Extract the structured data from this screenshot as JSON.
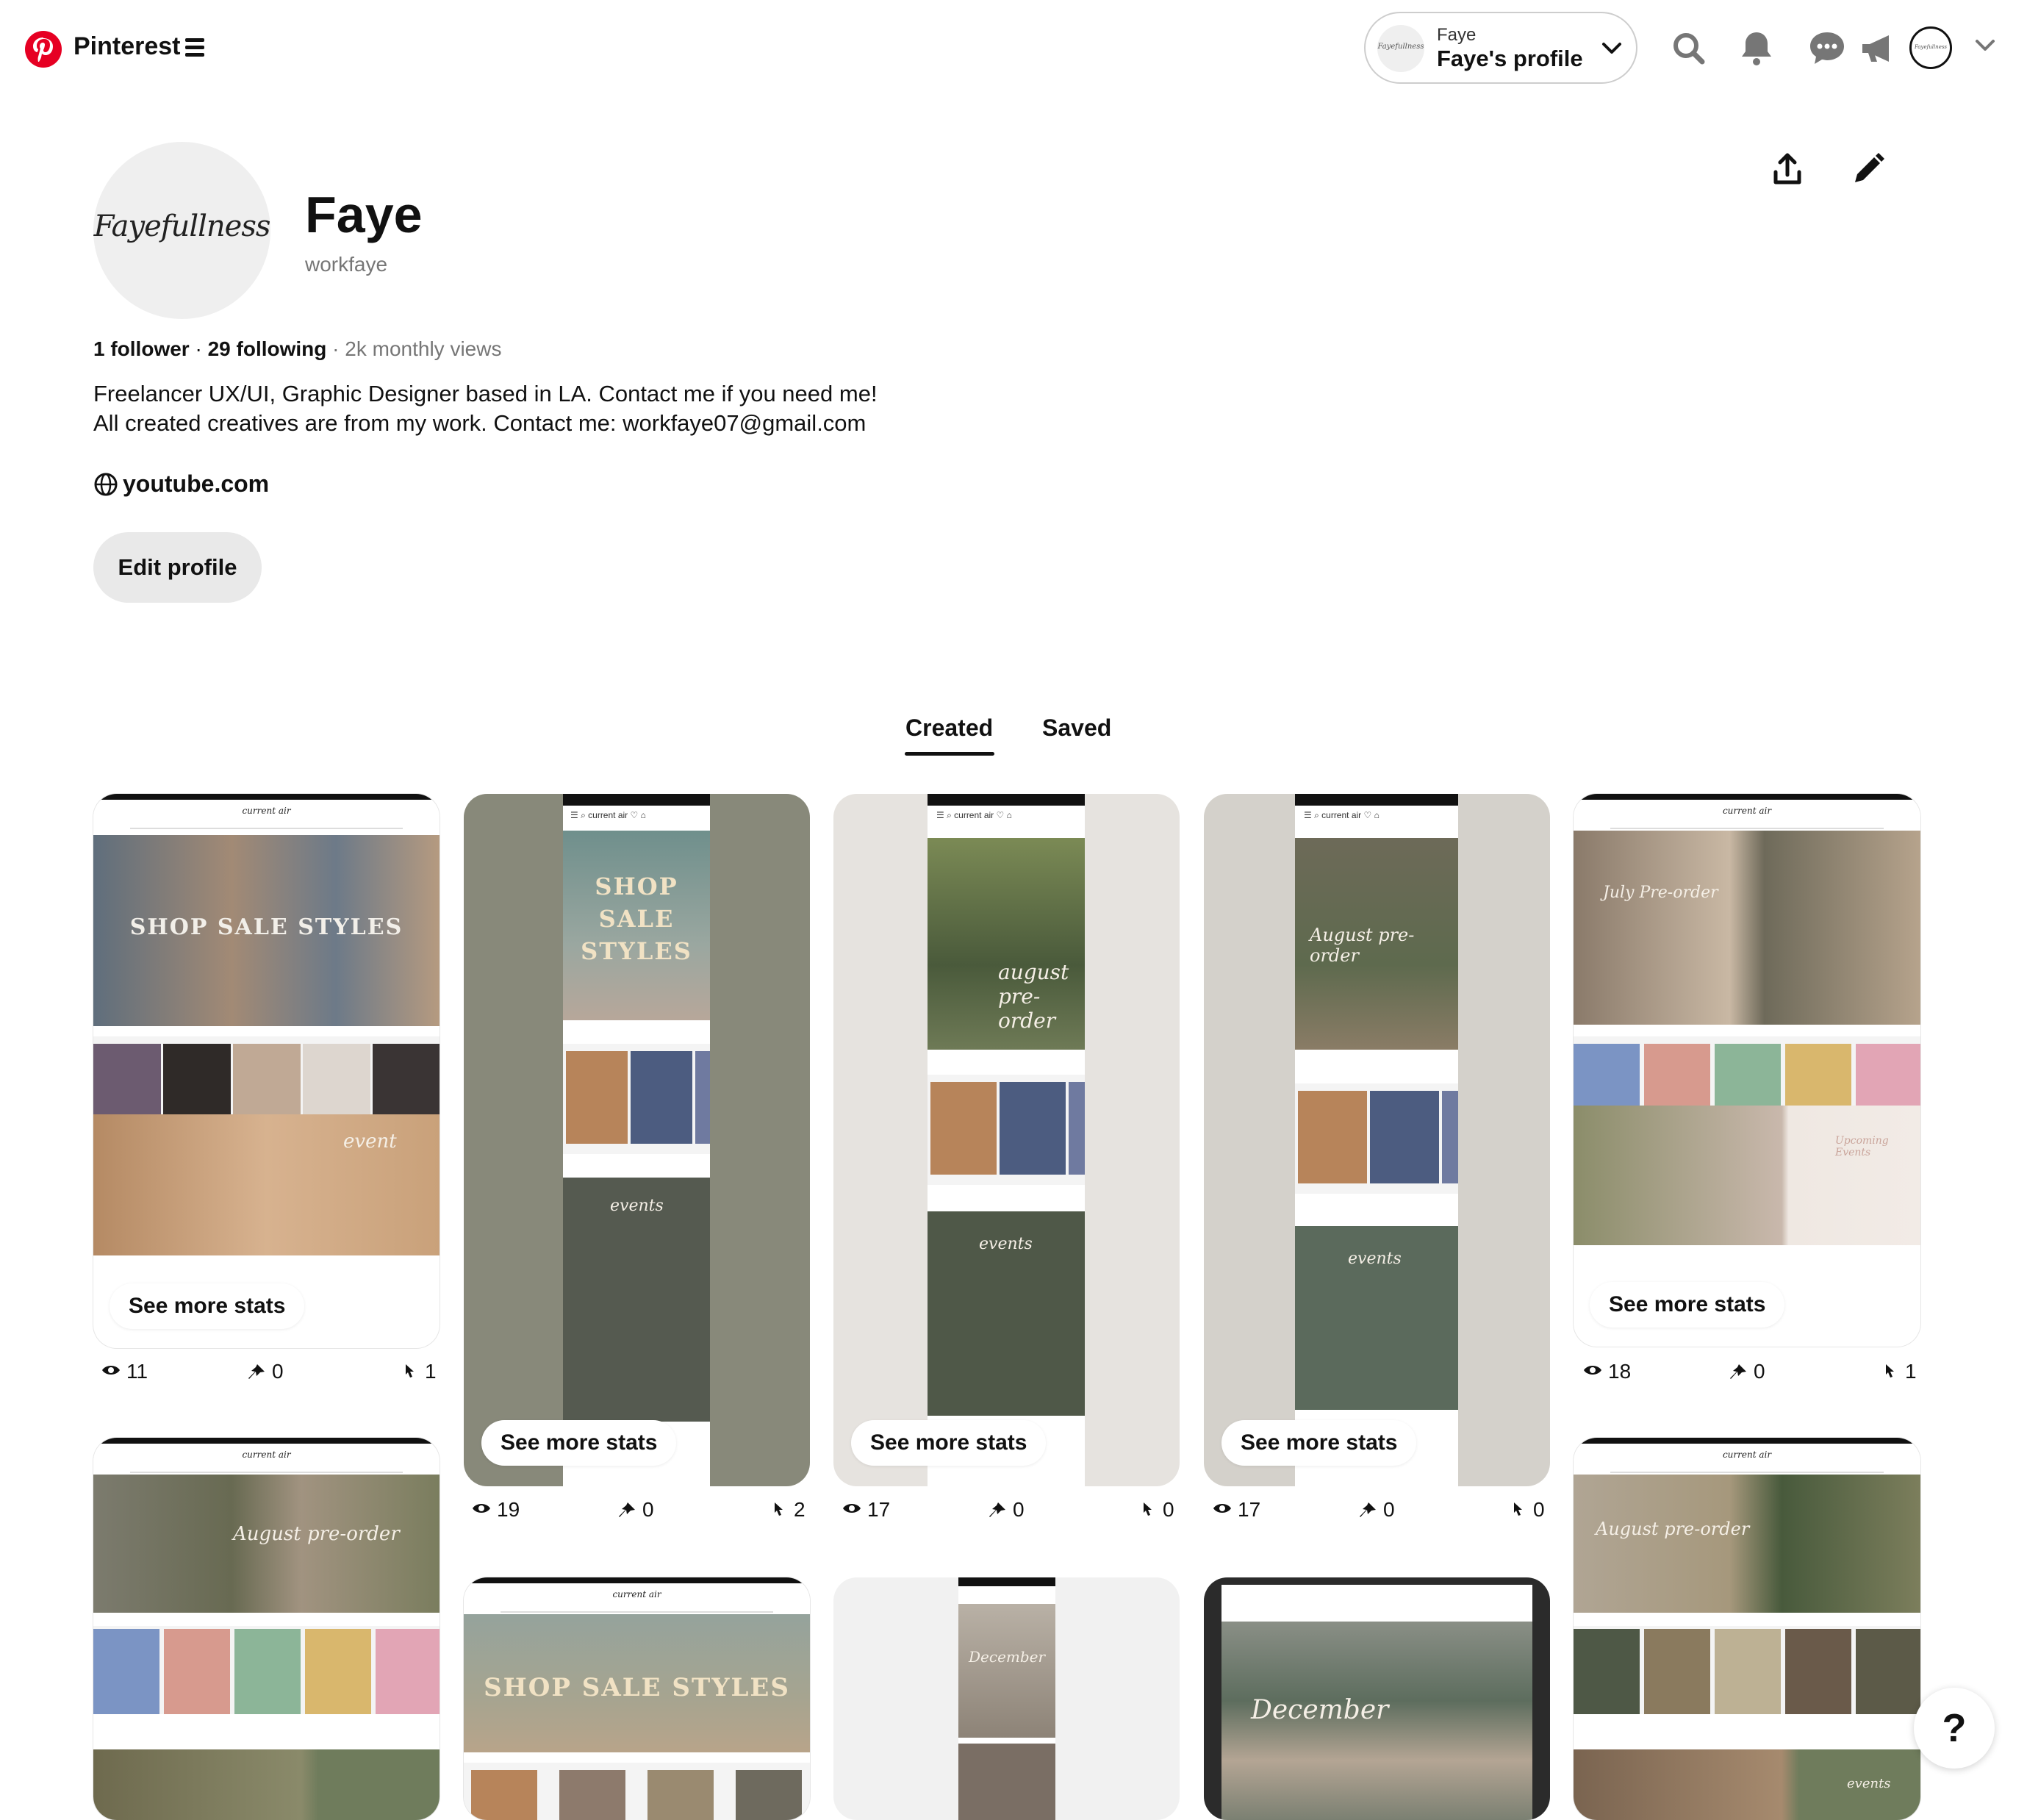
{
  "header": {
    "brand": "Pinterest",
    "account_switcher": {
      "name": "Faye",
      "profile_label": "Faye's profile",
      "avatar_text": "Fayefullness"
    },
    "icons": [
      "search-icon",
      "bell-icon",
      "messages-icon",
      "megaphone-icon"
    ],
    "avatar_text": "Fayefullness"
  },
  "profile": {
    "avatar_text": "Fayefullness",
    "name": "Faye",
    "handle": "workfaye",
    "followers": "1 follower",
    "following": "29 following",
    "monthly_views": "2k monthly views",
    "bio_line1": "Freelancer UX/UI, Graphic Designer based in LA. Contact me if you need me!",
    "bio_line2": "All created creatives are from my work. Contact me: workfaye07@gmail.com",
    "website": "youtube.com",
    "edit_button": "Edit profile"
  },
  "tabs": {
    "created": "Created",
    "saved": "Saved",
    "active": "Created"
  },
  "pins": [
    {
      "overlay": "SHOP SALE STYLES",
      "stats_button": "See more stats",
      "views": "11",
      "saves": "0",
      "clicks": "1"
    },
    {
      "overlay": "SHOP SALE STYLES",
      "stats_button": "See more stats",
      "views": "19",
      "saves": "0",
      "clicks": "2"
    },
    {
      "overlay": "august pre-order",
      "stats_button": "See more stats",
      "views": "17",
      "saves": "0",
      "clicks": "0"
    },
    {
      "overlay": "August pre-order",
      "stats_button": "See more stats",
      "views": "17",
      "saves": "0",
      "clicks": "0"
    },
    {
      "overlay": "July Pre-order",
      "stats_button": "See more stats",
      "views": "18",
      "saves": "0",
      "clicks": "1"
    },
    {
      "overlay": "August pre-order"
    },
    {
      "overlay": "SHOP SALE STYLES"
    },
    {
      "overlay": "December"
    },
    {
      "overlay": "December"
    },
    {
      "overlay": "August pre-order"
    }
  ],
  "help_button": "?",
  "colors": {
    "brand_red": "#e60023",
    "pill_grey": "#e9e9e9",
    "muted_text": "#767676"
  }
}
